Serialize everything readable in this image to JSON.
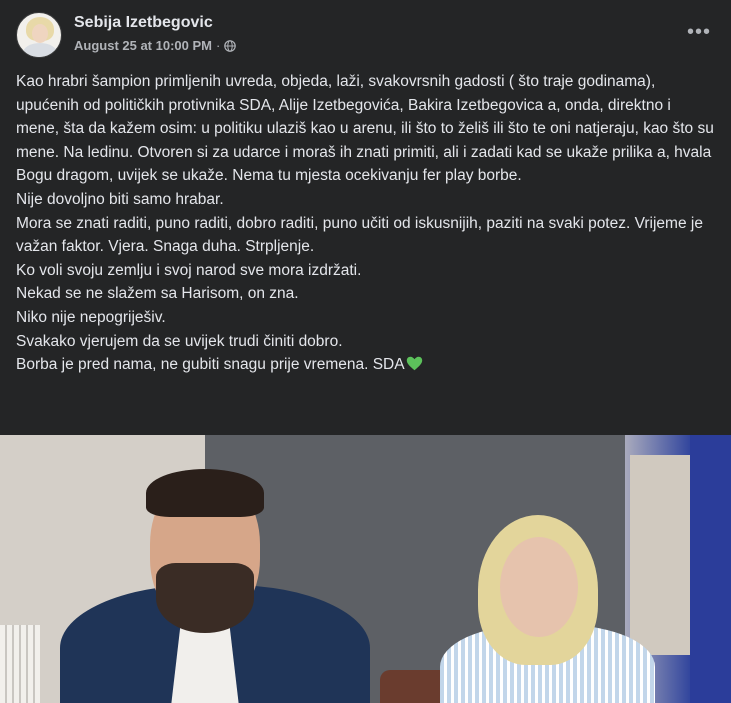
{
  "post": {
    "author": "Sebija Izetbegovic",
    "timestamp": "August 25 at 10:00 PM",
    "separator": "·",
    "audience_icon": "globe-icon",
    "more_label": "•••",
    "paragraphs": [
      "Kao hrabri šampion primljenih uvreda, objeda, laži, svakovrsnih gadosti ( što traje godinama), upućenih od političkih protivnika SDA, Alije Izetbegovića, Bakira Izetbegovica a, onda, direktno i mene, šta da kažem osim: u politiku ulaziš kao u arenu, ili što to želiš ili što te oni natjeraju, kao što su mene. Na ledinu. Otvoren si za udarce i moraš ih znati primiti, ali i zadati kad se ukaže prilika a, hvala Bogu dragom, uvijek se ukaže. Nema tu mjesta ocekivanju fer play borbe.",
      "Nije dovoljno biti samo hrabar.",
      "Mora se znati raditi, puno raditi, dobro raditi, puno učiti od iskusnijih, paziti na svaki potez. Vrijeme je važan faktor. Vjera. Snaga duha. Strpljenje.",
      "Ko voli svoju zemlju i svoj narod sve mora izdržati.",
      "Nekad se ne slažem sa Harisom, on zna.",
      "Niko nije nepogriješiv.",
      "Svakako vjerujem da se uvijek trudi činiti dobro.",
      "Borba je pred nama, ne gubiti snagu prije vremena. SDA"
    ],
    "emoji_icon": "green-heart-icon",
    "colors": {
      "background": "#242526",
      "text": "#e4e6eb",
      "secondary_text": "#b0b3b8",
      "heart": "#5cc15b"
    }
  }
}
